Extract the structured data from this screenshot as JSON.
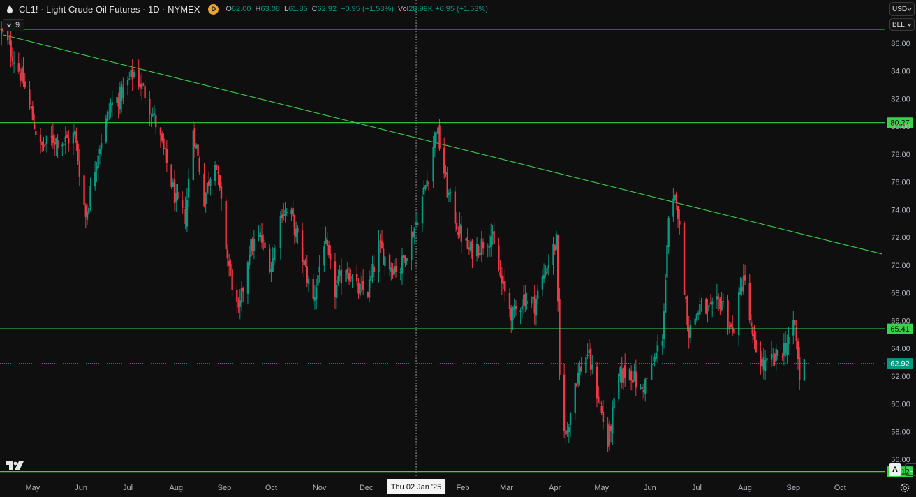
{
  "header": {
    "symbol": "CL1!",
    "name": "Light Crude Oil Futures",
    "interval": "1D",
    "exchange": "NYMEX",
    "title": "CL1! · Light Crude Oil Futures · 1D · NYMEX",
    "badge": "D",
    "open_label": "O",
    "open": "62.00",
    "high_label": "H",
    "high": "63.08",
    "low_label": "L",
    "low": "61.85",
    "close_label": "C",
    "close": "62.92",
    "change": "+0.95 (+1.53%)",
    "vol_label": "Vol",
    "vol": "28.99",
    "vol_change": "K +0.95 (+1.53%)",
    "indicators_count": "9"
  },
  "right_controls": {
    "currency": "USD",
    "unit": "BLL"
  },
  "bottom_controls": {
    "auto": "A",
    "log": "L"
  },
  "icons": [
    "oil-drop-icon",
    "chevron-down-icon",
    "tradingview-logo",
    "settings-icon"
  ],
  "colors": {
    "up": "#089981",
    "down": "#f23645",
    "level_lines": "#38d14a",
    "background": "#0f0f0f"
  },
  "chart_data": {
    "type": "candlestick",
    "title": "CL1! · Light Crude Oil Futures · 1D · NYMEX",
    "x_tick_labels": [
      "May",
      "Jun",
      "Jul",
      "Aug",
      "Sep",
      "Oct",
      "Nov",
      "Dec",
      "Thu 02 Jan '25",
      "Feb",
      "Mar",
      "Apr",
      "May",
      "Jun",
      "Jul",
      "Aug",
      "Sep",
      "Oct"
    ],
    "y_tick_labels": [
      "56.00",
      "58.00",
      "60.00",
      "62.00",
      "64.00",
      "66.00",
      "68.00",
      "70.00",
      "72.00",
      "74.00",
      "76.00",
      "78.00",
      "80.00",
      "82.00",
      "84.00",
      "86.00"
    ],
    "ylim": [
      54.7,
      87.7
    ],
    "xlim": [
      "2024-04-10",
      "2025-10-30"
    ],
    "crosshair_date": "2025-01-02",
    "horizontal_levels": [
      {
        "value": 87.0,
        "label": ""
      },
      {
        "value": 80.27,
        "label": "80.27"
      },
      {
        "value": 65.41,
        "label": "65.41"
      },
      {
        "value": 55.12,
        "label": "55.12"
      }
    ],
    "last_price": {
      "value": 62.92,
      "label": "62.92"
    },
    "trendline": {
      "start": {
        "date": "2024-04-12",
        "price": 86.6
      },
      "end": {
        "date": "2025-10-28",
        "price": 70.8
      }
    },
    "close_anchors": [
      [
        "2024-04-11",
        86.8
      ],
      [
        "2024-04-18",
        85.2
      ],
      [
        "2024-04-25",
        83.2
      ],
      [
        "2024-04-30",
        81.0
      ],
      [
        "2024-05-06",
        78.4
      ],
      [
        "2024-05-14",
        79.1
      ],
      [
        "2024-05-21",
        78.9
      ],
      [
        "2024-05-28",
        79.4
      ],
      [
        "2024-06-04",
        73.5
      ],
      [
        "2024-06-12",
        78.3
      ],
      [
        "2024-06-20",
        81.5
      ],
      [
        "2024-06-27",
        82.3
      ],
      [
        "2024-07-05",
        83.9
      ],
      [
        "2024-07-12",
        82.4
      ],
      [
        "2024-07-19",
        80.2
      ],
      [
        "2024-07-26",
        77.3
      ],
      [
        "2024-08-02",
        74.1
      ],
      [
        "2024-08-07",
        73.5
      ],
      [
        "2024-08-12",
        79.9
      ],
      [
        "2024-08-19",
        74.8
      ],
      [
        "2024-08-26",
        77.9
      ],
      [
        "2024-09-03",
        70.5
      ],
      [
        "2024-09-10",
        66.3
      ],
      [
        "2024-09-17",
        71.2
      ],
      [
        "2024-09-24",
        72.0
      ],
      [
        "2024-10-01",
        69.9
      ],
      [
        "2024-10-08",
        74.0
      ],
      [
        "2024-10-14",
        73.5
      ],
      [
        "2024-10-21",
        70.5
      ],
      [
        "2024-10-28",
        67.4
      ],
      [
        "2024-11-04",
        71.8
      ],
      [
        "2024-11-11",
        68.1
      ],
      [
        "2024-11-18",
        70.0
      ],
      [
        "2024-11-25",
        68.2
      ],
      [
        "2024-12-02",
        68.1
      ],
      [
        "2024-12-09",
        71.3
      ],
      [
        "2024-12-16",
        70.0
      ],
      [
        "2024-12-23",
        69.8
      ],
      [
        "2025-01-02",
        73.1
      ],
      [
        "2025-01-10",
        76.6
      ],
      [
        "2025-01-15",
        80.0
      ],
      [
        "2025-01-22",
        75.4
      ],
      [
        "2025-01-29",
        72.6
      ],
      [
        "2025-02-05",
        71.0
      ],
      [
        "2025-02-12",
        71.4
      ],
      [
        "2025-02-19",
        72.2
      ],
      [
        "2025-02-26",
        68.6
      ],
      [
        "2025-03-05",
        66.3
      ],
      [
        "2025-03-12",
        67.7
      ],
      [
        "2025-03-19",
        67.2
      ],
      [
        "2025-03-26",
        69.7
      ],
      [
        "2025-04-02",
        71.7
      ],
      [
        "2025-04-04",
        61.9
      ],
      [
        "2025-04-08",
        57.5
      ],
      [
        "2025-04-14",
        61.6
      ],
      [
        "2025-04-22",
        63.7
      ],
      [
        "2025-04-29",
        60.4
      ],
      [
        "2025-05-05",
        57.1
      ],
      [
        "2025-05-12",
        61.9
      ],
      [
        "2025-05-19",
        62.5
      ],
      [
        "2025-05-26",
        60.8
      ],
      [
        "2025-06-02",
        62.5
      ],
      [
        "2025-06-09",
        65.0
      ],
      [
        "2025-06-13",
        72.9
      ],
      [
        "2025-06-18",
        75.1
      ],
      [
        "2025-06-23",
        68.5
      ],
      [
        "2025-06-26",
        65.2
      ],
      [
        "2025-07-03",
        67.0
      ],
      [
        "2025-07-10",
        66.6
      ],
      [
        "2025-07-17",
        67.5
      ],
      [
        "2025-07-24",
        65.0
      ],
      [
        "2025-07-31",
        69.3
      ],
      [
        "2025-08-06",
        64.4
      ],
      [
        "2025-08-13",
        62.7
      ],
      [
        "2025-08-20",
        63.2
      ],
      [
        "2025-08-27",
        64.2
      ],
      [
        "2025-09-02",
        65.6
      ],
      [
        "2025-09-05",
        61.9
      ],
      [
        "2025-09-08",
        62.9
      ]
    ],
    "grid": false,
    "legend": "top-left"
  }
}
